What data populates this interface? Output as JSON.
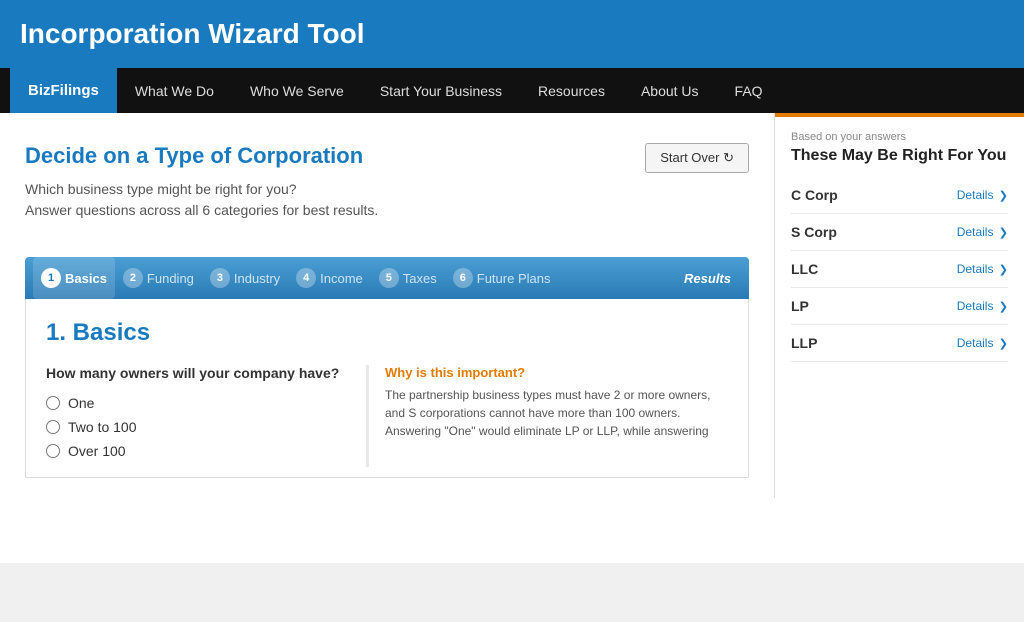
{
  "banner": {
    "title": "Incorporation Wizard Tool"
  },
  "nav": {
    "brand": "BizFilings",
    "items": [
      {
        "label": "What We Do"
      },
      {
        "label": "Who We Serve"
      },
      {
        "label": "Start Your Business"
      },
      {
        "label": "Resources"
      },
      {
        "label": "About Us"
      },
      {
        "label": "FAQ"
      }
    ]
  },
  "main": {
    "page_title": "Decide on a Type of Corporation",
    "subtitle_line1": "Which business type might be right for you?",
    "subtitle_line2": "Answer questions across all 6 categories for best results.",
    "start_over_label": "Start Over",
    "section_heading": "1. Basics",
    "question": "How many owners will your company have?",
    "options": [
      {
        "label": "One",
        "value": "one"
      },
      {
        "label": "Two to 100",
        "value": "two_to_100"
      },
      {
        "label": "Over 100",
        "value": "over_100"
      }
    ],
    "why_title": "Why is this important?",
    "why_text": "The partnership business types must have 2 or more owners, and S corporations cannot have more than 100 owners. Answering \"One\" would eliminate LP or LLP, while answering"
  },
  "steps": [
    {
      "num": "1",
      "label": "Basics",
      "active": true
    },
    {
      "num": "2",
      "label": "Funding",
      "active": false
    },
    {
      "num": "3",
      "label": "Industry",
      "active": false
    },
    {
      "num": "4",
      "label": "Income",
      "active": false
    },
    {
      "num": "5",
      "label": "Taxes",
      "active": false
    },
    {
      "num": "6",
      "label": "Future Plans",
      "active": false
    }
  ],
  "results_label": "Results",
  "sidebar": {
    "based_on": "Based on your answers",
    "heading": "These May Be Right For You",
    "corps": [
      {
        "name": "C Corp",
        "details": "Details"
      },
      {
        "name": "S Corp",
        "details": "Details"
      },
      {
        "name": "LLC",
        "details": "Details"
      },
      {
        "name": "LP",
        "details": "Details"
      },
      {
        "name": "LLP",
        "details": "Details"
      }
    ]
  }
}
